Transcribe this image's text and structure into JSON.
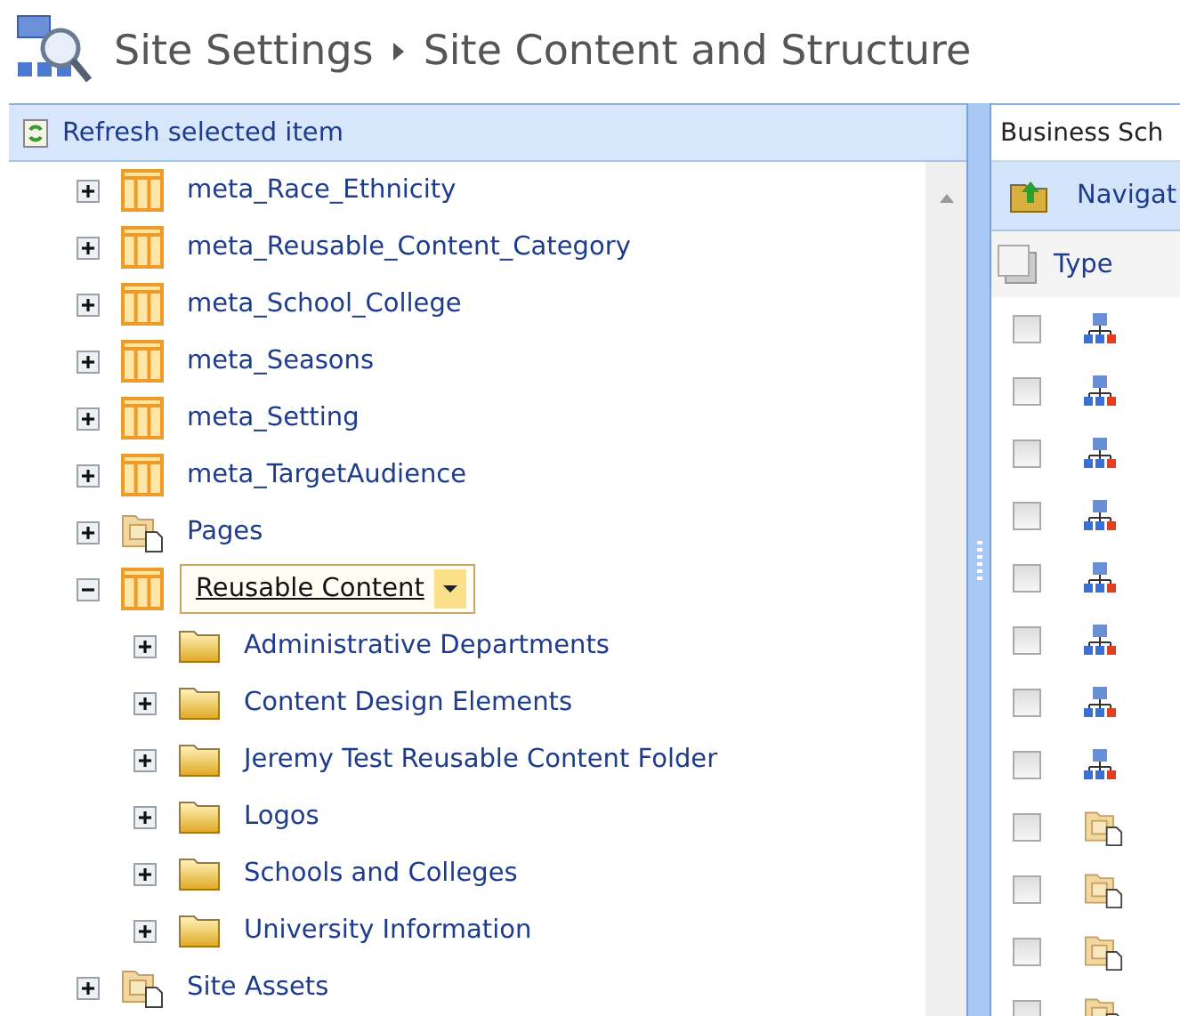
{
  "header": {
    "crumbs": [
      "Site Settings",
      "Site Content and Structure"
    ]
  },
  "tree": {
    "toolbar": {
      "label": "Refresh selected item"
    },
    "items": [
      {
        "kind": "list",
        "label": "meta_Race_Ethnicity",
        "expanded": false,
        "selected": false
      },
      {
        "kind": "list",
        "label": "meta_Reusable_Content_Category",
        "expanded": false,
        "selected": false
      },
      {
        "kind": "list",
        "label": "meta_School_College",
        "expanded": false,
        "selected": false
      },
      {
        "kind": "list",
        "label": "meta_Seasons",
        "expanded": false,
        "selected": false
      },
      {
        "kind": "list",
        "label": "meta_Setting",
        "expanded": false,
        "selected": false
      },
      {
        "kind": "list",
        "label": "meta_TargetAudience",
        "expanded": false,
        "selected": false
      },
      {
        "kind": "library",
        "label": "Pages",
        "expanded": false,
        "selected": false
      },
      {
        "kind": "list",
        "label": "Reusable Content",
        "expanded": true,
        "selected": true,
        "children": [
          {
            "kind": "folder",
            "label": "Administrative Departments",
            "expanded": false,
            "selected": false
          },
          {
            "kind": "folder",
            "label": "Content Design Elements",
            "expanded": false,
            "selected": false
          },
          {
            "kind": "folder",
            "label": "Jeremy Test Reusable Content Folder",
            "expanded": false,
            "selected": false
          },
          {
            "kind": "folder",
            "label": "Logos",
            "expanded": false,
            "selected": false
          },
          {
            "kind": "folder",
            "label": "Schools and Colleges",
            "expanded": false,
            "selected": false
          },
          {
            "kind": "folder",
            "label": "University Information",
            "expanded": false,
            "selected": false
          }
        ]
      },
      {
        "kind": "library",
        "label": "Site Assets",
        "expanded": false,
        "selected": false
      }
    ]
  },
  "content": {
    "breadcrumb": "Business Sch",
    "nav_button": "Navigat",
    "columns": [
      "Type"
    ],
    "rows": [
      {
        "kind": "site",
        "checked": false
      },
      {
        "kind": "site",
        "checked": false
      },
      {
        "kind": "site",
        "checked": false
      },
      {
        "kind": "site",
        "checked": false
      },
      {
        "kind": "site",
        "checked": false
      },
      {
        "kind": "site",
        "checked": false
      },
      {
        "kind": "site",
        "checked": false
      },
      {
        "kind": "site",
        "checked": false
      },
      {
        "kind": "library",
        "checked": false
      },
      {
        "kind": "library",
        "checked": false
      },
      {
        "kind": "library",
        "checked": false
      },
      {
        "kind": "library",
        "checked": false
      }
    ]
  }
}
